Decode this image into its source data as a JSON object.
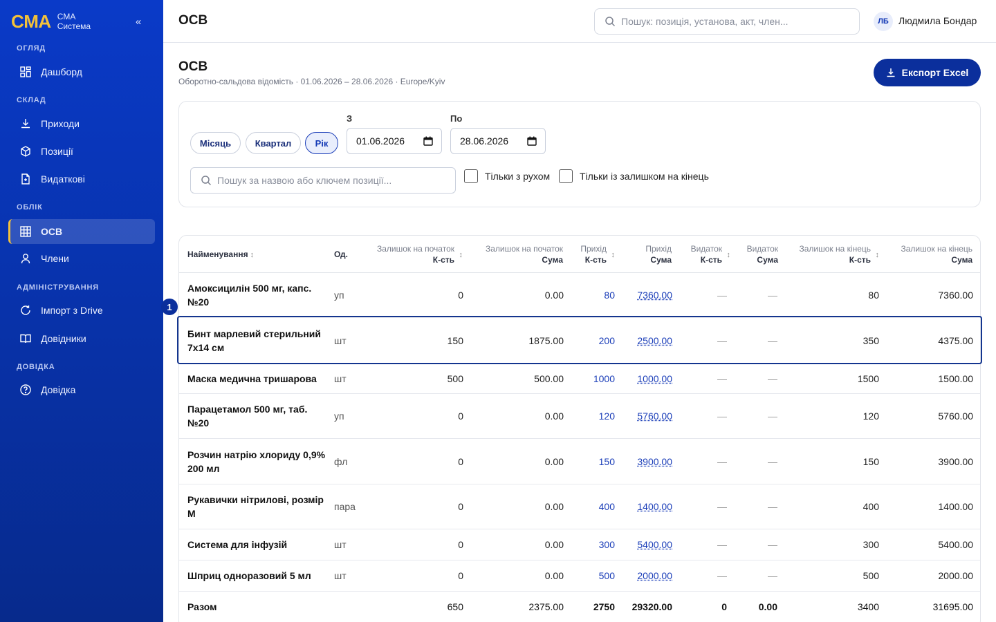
{
  "sidebar": {
    "logo": "CMA",
    "brand_line1": "CMA",
    "brand_line2": "Система",
    "collapse_symbol": "«",
    "sections": {
      "overview": "ОГЛЯД",
      "stock": "СКЛАД",
      "accounting": "ОБЛІК",
      "admin": "АДМІНІСТРУВАННЯ",
      "help": "ДОВІДКА"
    },
    "items": {
      "dashboard": "Дашборд",
      "receipts": "Приходи",
      "positions": "Позиції",
      "expenses": "Видаткові",
      "osv": "ОСВ",
      "members": "Члени",
      "import": "Імпорт з Drive",
      "directories": "Довідники",
      "help": "Довідка"
    },
    "active_item": "osv"
  },
  "header": {
    "title": "ОСВ",
    "search_placeholder": "Пошук: позиція, установа, акт, член...",
    "avatar_initials": "ЛБ",
    "user_name": "Людмила Бондар"
  },
  "page": {
    "title": "ОСВ",
    "subtitle": "Оборотно-сальдова відомість · 01.06.2026 – 28.06.2026 · Europe/Kyiv",
    "export_label": "Експорт Excel"
  },
  "filters": {
    "periods": [
      "Місяць",
      "Квартал",
      "Рік"
    ],
    "active_period": "Рік",
    "from_label": "З",
    "from_value": "01.06.2026",
    "to_label": "По",
    "to_value": "28.06.2026",
    "search_placeholder": "Пошук за назвою або ключем позиції...",
    "only_movement_label": "Тільки з рухом",
    "only_movement_checked": false,
    "only_end_balance_label": "Тільки із залишком на кінець",
    "only_end_balance_checked": false
  },
  "table": {
    "headers": {
      "name": "Найменування",
      "unit": "Од.",
      "open_qty_top": "Залишок на початок",
      "open_qty_bottom": "К-сть",
      "open_sum_top": "Залишок на початок",
      "open_sum_bottom": "Сума",
      "in_qty_top": "Прихід",
      "in_qty_bottom": "К-сть",
      "in_sum_top": "Прихід",
      "in_sum_bottom": "Сума",
      "out_qty_top": "Видаток",
      "out_qty_bottom": "К-сть",
      "out_sum_top": "Видаток",
      "out_sum_bottom": "Сума",
      "close_qty_top": "Залишок на кінець",
      "close_qty_bottom": "К-сть",
      "close_sum_top": "Залишок на кінець",
      "close_sum_bottom": "Сума",
      "sort_symbol": "↕"
    },
    "rows": [
      {
        "name": "Амоксицилін 500 мг, капс. №20",
        "unit": "уп",
        "open_qty": "0",
        "open_sum": "0.00",
        "in_qty": "80",
        "in_sum": "7360.00",
        "out_qty": "—",
        "out_sum": "—",
        "close_qty": "80",
        "close_sum": "7360.00"
      },
      {
        "name": "Бинт марлевий стерильний 7x14 см",
        "unit": "шт",
        "open_qty": "150",
        "open_sum": "1875.00",
        "in_qty": "200",
        "in_sum": "2500.00",
        "out_qty": "—",
        "out_sum": "—",
        "close_qty": "350",
        "close_sum": "4375.00"
      },
      {
        "name": "Маска медична тришарова",
        "unit": "шт",
        "open_qty": "500",
        "open_sum": "500.00",
        "in_qty": "1000",
        "in_sum": "1000.00",
        "out_qty": "—",
        "out_sum": "—",
        "close_qty": "1500",
        "close_sum": "1500.00"
      },
      {
        "name": "Парацетамол 500 мг, таб. №20",
        "unit": "уп",
        "open_qty": "0",
        "open_sum": "0.00",
        "in_qty": "120",
        "in_sum": "5760.00",
        "out_qty": "—",
        "out_sum": "—",
        "close_qty": "120",
        "close_sum": "5760.00"
      },
      {
        "name": "Розчин натрію хлориду 0,9% 200 мл",
        "unit": "фл",
        "open_qty": "0",
        "open_sum": "0.00",
        "in_qty": "150",
        "in_sum": "3900.00",
        "out_qty": "—",
        "out_sum": "—",
        "close_qty": "150",
        "close_sum": "3900.00"
      },
      {
        "name": "Рукавички нітрилові, розмір M",
        "unit": "пара",
        "open_qty": "0",
        "open_sum": "0.00",
        "in_qty": "400",
        "in_sum": "1400.00",
        "out_qty": "—",
        "out_sum": "—",
        "close_qty": "400",
        "close_sum": "1400.00"
      },
      {
        "name": "Система для інфузій",
        "unit": "шт",
        "open_qty": "0",
        "open_sum": "0.00",
        "in_qty": "300",
        "in_sum": "5400.00",
        "out_qty": "—",
        "out_sum": "—",
        "close_qty": "300",
        "close_sum": "5400.00"
      },
      {
        "name": "Шприц одноразовий 5 мл",
        "unit": "шт",
        "open_qty": "0",
        "open_sum": "0.00",
        "in_qty": "500",
        "in_sum": "2000.00",
        "out_qty": "—",
        "out_sum": "—",
        "close_qty": "500",
        "close_sum": "2000.00"
      }
    ],
    "total": {
      "label": "Разом",
      "open_qty": "650",
      "open_sum": "2375.00",
      "in_qty": "2750",
      "in_sum": "29320.00",
      "out_qty": "0",
      "out_sum": "0.00",
      "close_qty": "3400",
      "close_sum": "31695.00"
    },
    "highlighted_row_index": 1,
    "step_badge": "1"
  },
  "colors": {
    "sidebar_bg": "#0a3ac8",
    "accent_gold": "#f3c13a",
    "primary_button": "#0b2f9c",
    "link_blue": "#1a3db8"
  }
}
